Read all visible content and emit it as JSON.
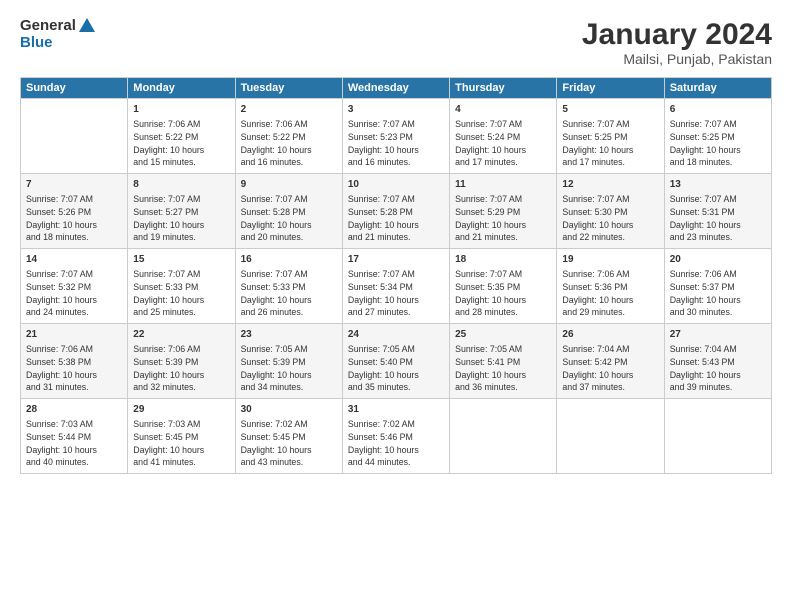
{
  "logo": {
    "line1": "General",
    "line2": "Blue"
  },
  "title": "January 2024",
  "subtitle": "Mailsi, Punjab, Pakistan",
  "days_header": [
    "Sunday",
    "Monday",
    "Tuesday",
    "Wednesday",
    "Thursday",
    "Friday",
    "Saturday"
  ],
  "weeks": [
    [
      {
        "day": "",
        "lines": []
      },
      {
        "day": "1",
        "lines": [
          "Sunrise: 7:06 AM",
          "Sunset: 5:22 PM",
          "Daylight: 10 hours",
          "and 15 minutes."
        ]
      },
      {
        "day": "2",
        "lines": [
          "Sunrise: 7:06 AM",
          "Sunset: 5:22 PM",
          "Daylight: 10 hours",
          "and 16 minutes."
        ]
      },
      {
        "day": "3",
        "lines": [
          "Sunrise: 7:07 AM",
          "Sunset: 5:23 PM",
          "Daylight: 10 hours",
          "and 16 minutes."
        ]
      },
      {
        "day": "4",
        "lines": [
          "Sunrise: 7:07 AM",
          "Sunset: 5:24 PM",
          "Daylight: 10 hours",
          "and 17 minutes."
        ]
      },
      {
        "day": "5",
        "lines": [
          "Sunrise: 7:07 AM",
          "Sunset: 5:25 PM",
          "Daylight: 10 hours",
          "and 17 minutes."
        ]
      },
      {
        "day": "6",
        "lines": [
          "Sunrise: 7:07 AM",
          "Sunset: 5:25 PM",
          "Daylight: 10 hours",
          "and 18 minutes."
        ]
      }
    ],
    [
      {
        "day": "7",
        "lines": [
          "Sunrise: 7:07 AM",
          "Sunset: 5:26 PM",
          "Daylight: 10 hours",
          "and 18 minutes."
        ]
      },
      {
        "day": "8",
        "lines": [
          "Sunrise: 7:07 AM",
          "Sunset: 5:27 PM",
          "Daylight: 10 hours",
          "and 19 minutes."
        ]
      },
      {
        "day": "9",
        "lines": [
          "Sunrise: 7:07 AM",
          "Sunset: 5:28 PM",
          "Daylight: 10 hours",
          "and 20 minutes."
        ]
      },
      {
        "day": "10",
        "lines": [
          "Sunrise: 7:07 AM",
          "Sunset: 5:28 PM",
          "Daylight: 10 hours",
          "and 21 minutes."
        ]
      },
      {
        "day": "11",
        "lines": [
          "Sunrise: 7:07 AM",
          "Sunset: 5:29 PM",
          "Daylight: 10 hours",
          "and 21 minutes."
        ]
      },
      {
        "day": "12",
        "lines": [
          "Sunrise: 7:07 AM",
          "Sunset: 5:30 PM",
          "Daylight: 10 hours",
          "and 22 minutes."
        ]
      },
      {
        "day": "13",
        "lines": [
          "Sunrise: 7:07 AM",
          "Sunset: 5:31 PM",
          "Daylight: 10 hours",
          "and 23 minutes."
        ]
      }
    ],
    [
      {
        "day": "14",
        "lines": [
          "Sunrise: 7:07 AM",
          "Sunset: 5:32 PM",
          "Daylight: 10 hours",
          "and 24 minutes."
        ]
      },
      {
        "day": "15",
        "lines": [
          "Sunrise: 7:07 AM",
          "Sunset: 5:33 PM",
          "Daylight: 10 hours",
          "and 25 minutes."
        ]
      },
      {
        "day": "16",
        "lines": [
          "Sunrise: 7:07 AM",
          "Sunset: 5:33 PM",
          "Daylight: 10 hours",
          "and 26 minutes."
        ]
      },
      {
        "day": "17",
        "lines": [
          "Sunrise: 7:07 AM",
          "Sunset: 5:34 PM",
          "Daylight: 10 hours",
          "and 27 minutes."
        ]
      },
      {
        "day": "18",
        "lines": [
          "Sunrise: 7:07 AM",
          "Sunset: 5:35 PM",
          "Daylight: 10 hours",
          "and 28 minutes."
        ]
      },
      {
        "day": "19",
        "lines": [
          "Sunrise: 7:06 AM",
          "Sunset: 5:36 PM",
          "Daylight: 10 hours",
          "and 29 minutes."
        ]
      },
      {
        "day": "20",
        "lines": [
          "Sunrise: 7:06 AM",
          "Sunset: 5:37 PM",
          "Daylight: 10 hours",
          "and 30 minutes."
        ]
      }
    ],
    [
      {
        "day": "21",
        "lines": [
          "Sunrise: 7:06 AM",
          "Sunset: 5:38 PM",
          "Daylight: 10 hours",
          "and 31 minutes."
        ]
      },
      {
        "day": "22",
        "lines": [
          "Sunrise: 7:06 AM",
          "Sunset: 5:39 PM",
          "Daylight: 10 hours",
          "and 32 minutes."
        ]
      },
      {
        "day": "23",
        "lines": [
          "Sunrise: 7:05 AM",
          "Sunset: 5:39 PM",
          "Daylight: 10 hours",
          "and 34 minutes."
        ]
      },
      {
        "day": "24",
        "lines": [
          "Sunrise: 7:05 AM",
          "Sunset: 5:40 PM",
          "Daylight: 10 hours",
          "and 35 minutes."
        ]
      },
      {
        "day": "25",
        "lines": [
          "Sunrise: 7:05 AM",
          "Sunset: 5:41 PM",
          "Daylight: 10 hours",
          "and 36 minutes."
        ]
      },
      {
        "day": "26",
        "lines": [
          "Sunrise: 7:04 AM",
          "Sunset: 5:42 PM",
          "Daylight: 10 hours",
          "and 37 minutes."
        ]
      },
      {
        "day": "27",
        "lines": [
          "Sunrise: 7:04 AM",
          "Sunset: 5:43 PM",
          "Daylight: 10 hours",
          "and 39 minutes."
        ]
      }
    ],
    [
      {
        "day": "28",
        "lines": [
          "Sunrise: 7:03 AM",
          "Sunset: 5:44 PM",
          "Daylight: 10 hours",
          "and 40 minutes."
        ]
      },
      {
        "day": "29",
        "lines": [
          "Sunrise: 7:03 AM",
          "Sunset: 5:45 PM",
          "Daylight: 10 hours",
          "and 41 minutes."
        ]
      },
      {
        "day": "30",
        "lines": [
          "Sunrise: 7:02 AM",
          "Sunset: 5:45 PM",
          "Daylight: 10 hours",
          "and 43 minutes."
        ]
      },
      {
        "day": "31",
        "lines": [
          "Sunrise: 7:02 AM",
          "Sunset: 5:46 PM",
          "Daylight: 10 hours",
          "and 44 minutes."
        ]
      },
      {
        "day": "",
        "lines": []
      },
      {
        "day": "",
        "lines": []
      },
      {
        "day": "",
        "lines": []
      }
    ]
  ]
}
